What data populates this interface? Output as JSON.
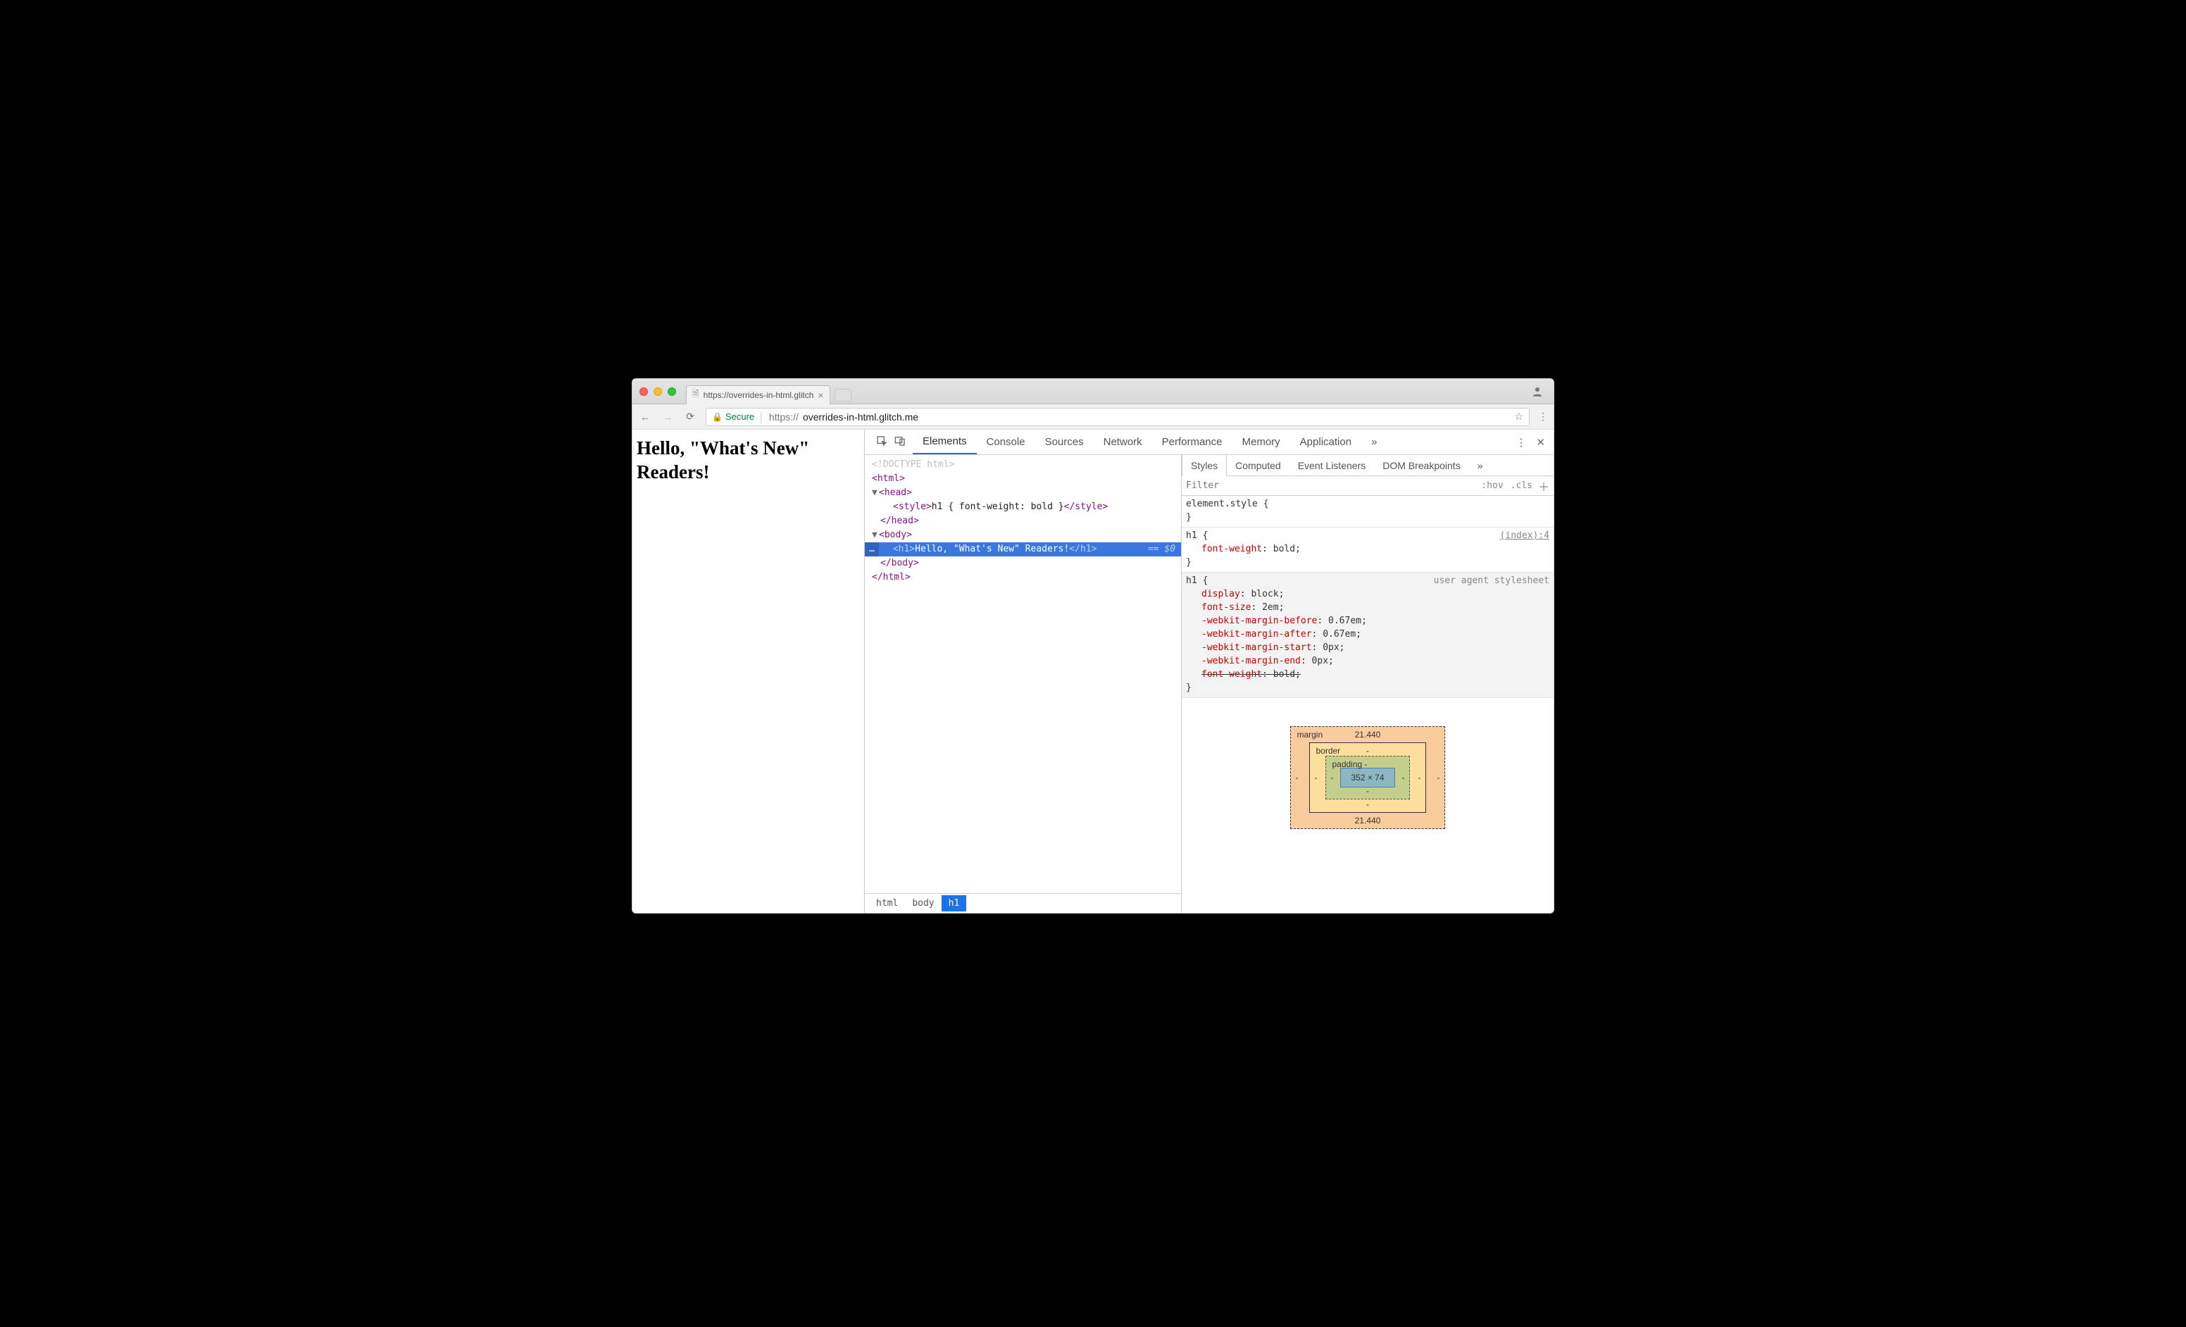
{
  "window": {
    "tab_title": "https://overrides-in-html.glitch",
    "secure_label": "Secure",
    "url_scheme": "https://",
    "url_host": "overrides-in-html.glitch.me"
  },
  "page": {
    "heading": "Hello, \"What's New\" Readers!"
  },
  "devtools": {
    "tabs": [
      "Elements",
      "Console",
      "Sources",
      "Network",
      "Performance",
      "Memory",
      "Application"
    ],
    "active_tab": "Elements"
  },
  "dom": {
    "doctype": "<!DOCTYPE html>",
    "html_open": "html",
    "head_open": "head",
    "style_tag_open": "style",
    "style_text": "h1 { font-weight: bold }",
    "style_tag_close": "/style",
    "head_close": "/head",
    "body_open": "body",
    "h1_open": "h1",
    "h1_text": "Hello, \"What's New\" Readers!",
    "h1_close": "/h1",
    "sel_eq": " == $0",
    "body_close": "/body",
    "html_close": "/html"
  },
  "breadcrumb": [
    "html",
    "body",
    "h1"
  ],
  "styles": {
    "tabs": [
      "Styles",
      "Computed",
      "Event Listeners",
      "DOM Breakpoints"
    ],
    "filter_placeholder": "Filter",
    "hov": ":hov",
    "cls": ".cls",
    "rule1": {
      "selector": "element.style {",
      "close": "}"
    },
    "rule2": {
      "selector": "h1 {",
      "src": "(index):4",
      "p1n": "font-weight",
      "p1v": "bold;",
      "close": "}"
    },
    "rule3": {
      "selector": "h1 {",
      "src": "user agent stylesheet",
      "p1n": "display",
      "p1v": "block;",
      "p2n": "font-size",
      "p2v": "2em;",
      "p3n": "-webkit-margin-before",
      "p3v": "0.67em;",
      "p4n": "-webkit-margin-after",
      "p4v": "0.67em;",
      "p5n": "-webkit-margin-start",
      "p5v": "0px;",
      "p6n": "-webkit-margin-end",
      "p6v": "0px;",
      "p7n": "font-weight",
      "p7v": "bold;",
      "close": "}"
    }
  },
  "boxmodel": {
    "margin_label": "margin",
    "margin_top": "21.440",
    "margin_bottom": "21.440",
    "margin_side": "-",
    "border_label": "border",
    "border_val": "-",
    "padding_label": "padding",
    "padding_val": "-",
    "content": "352 × 74"
  }
}
